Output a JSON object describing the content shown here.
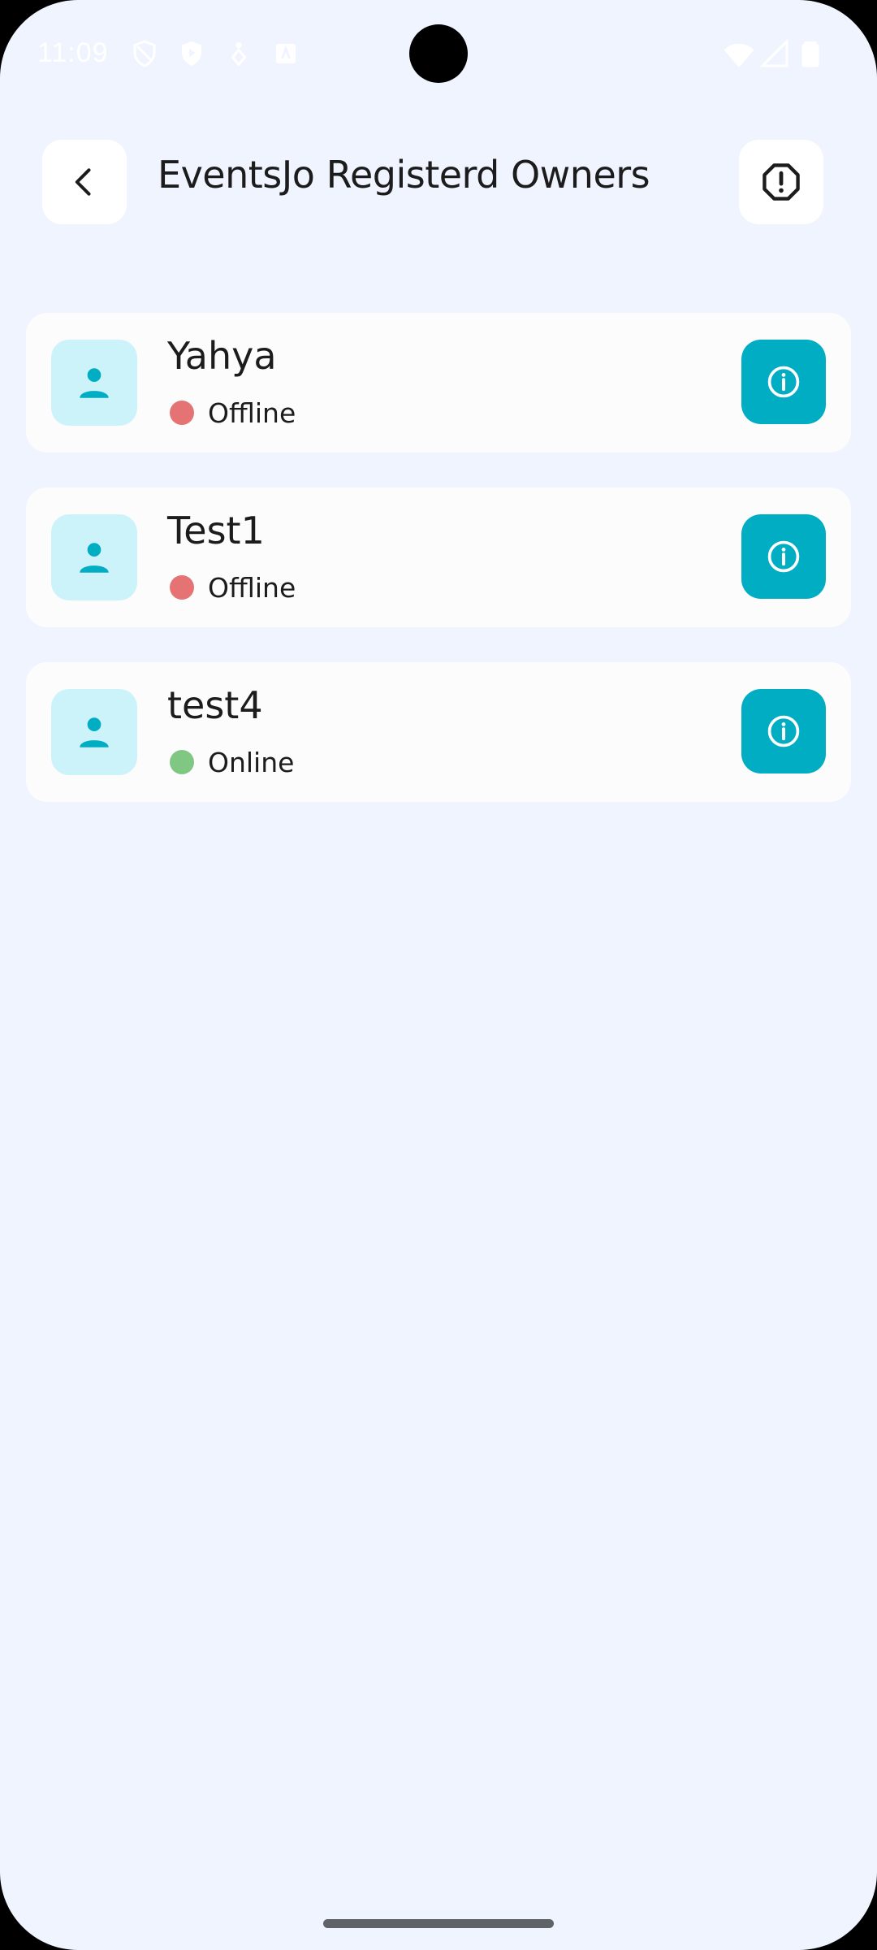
{
  "status_bar": {
    "time": "11:09",
    "icons": [
      "shield-icon",
      "shield-play-icon",
      "fitness-icon",
      "store-icon",
      "wifi-icon",
      "signal-icon",
      "battery-icon"
    ]
  },
  "header": {
    "title": "EventsJo Registerd Owners",
    "back_icon": "chevron-left-icon",
    "alert_icon": "octagon-alert-icon"
  },
  "owners": [
    {
      "name": "Yahya",
      "status": "Offline",
      "status_color": "#e57373"
    },
    {
      "name": "Test1",
      "status": "Offline",
      "status_color": "#e57373"
    },
    {
      "name": "test4",
      "status": "Online",
      "status_color": "#81c784"
    }
  ],
  "colors": {
    "background": "#eff4fe",
    "card": "#fcfcfd",
    "accent": "#00adc3",
    "avatar_bg": "#cdf3fa",
    "offline": "#e57373",
    "online": "#81c784"
  }
}
